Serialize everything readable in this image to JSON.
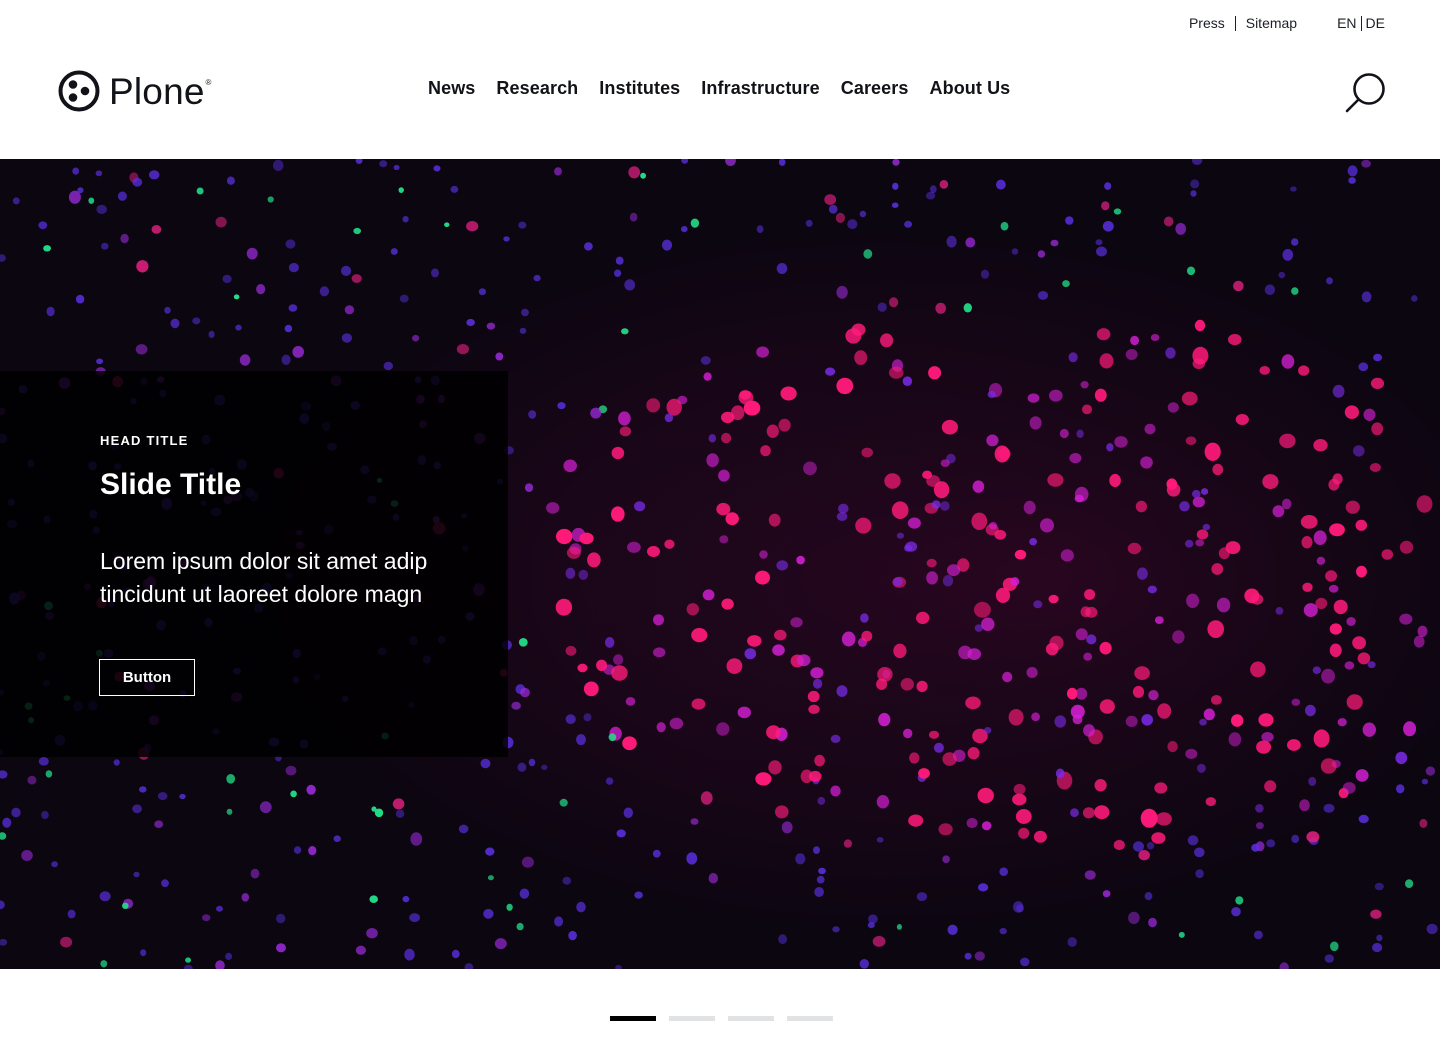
{
  "topbar": {
    "press": "Press",
    "sitemap": "Sitemap",
    "lang_en": "EN",
    "lang_de": "DE"
  },
  "header": {
    "logo_text": "Plone",
    "logo_mark": "®",
    "search_icon": "search-icon"
  },
  "nav": {
    "items": [
      {
        "label": "News"
      },
      {
        "label": "Research"
      },
      {
        "label": "Institutes"
      },
      {
        "label": "Infrastructure"
      },
      {
        "label": "Careers"
      },
      {
        "label": "About Us"
      }
    ]
  },
  "slide": {
    "head_title": "HEAD TITLE",
    "title": "Slide Title",
    "text": "Lorem ipsum dolor sit amet adip tincidunt ut laoreet dolore magn",
    "button_label": "Button",
    "image": "fluorescence microscopy of stained cells"
  },
  "pager": {
    "total": 4,
    "active_index": 0
  },
  "colors": {
    "text": "#111318",
    "accent_magenta": "#ff1a7a",
    "accent_violet": "#8a22e6",
    "accent_green": "#22dd88",
    "pager_active": "#000000",
    "pager_inactive": "#e1e2e4"
  }
}
